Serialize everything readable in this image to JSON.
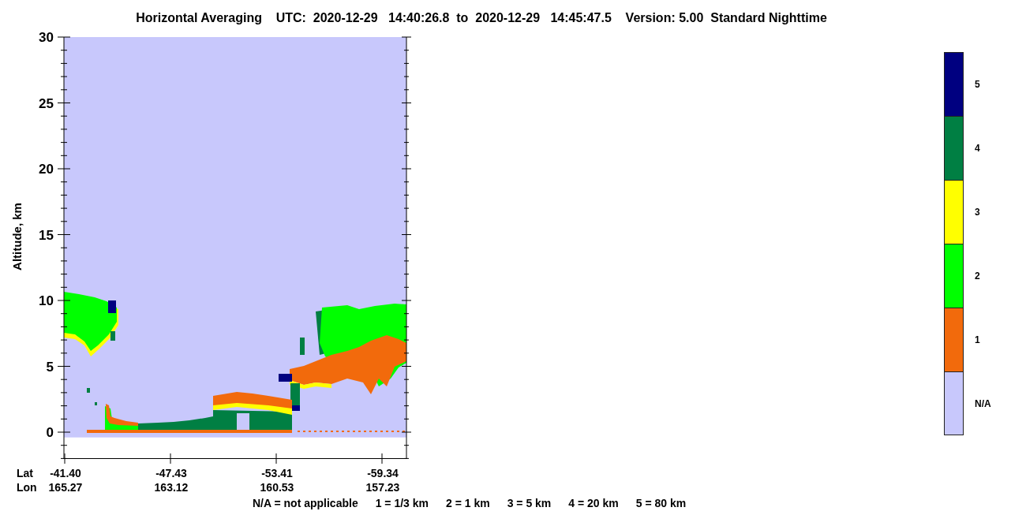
{
  "title": "Horizontal Averaging    UTC:  2020-12-29   14:40:26.8  to  2020-12-29   14:45:47.5    Version: 5.00  Standard Nighttime",
  "plot": {
    "y_axis_label": "Altitude, km",
    "y_ticks": [
      "30",
      "25",
      "20",
      "15",
      "10",
      "5",
      "0"
    ],
    "lat_label": "Lat",
    "lon_label": "Lon",
    "x_ticks": [
      {
        "lat": "-41.40",
        "lon": "165.27"
      },
      {
        "lat": "-47.43",
        "lon": "163.12"
      },
      {
        "lat": "-53.41",
        "lon": "160.53"
      },
      {
        "lat": "-59.34",
        "lon": "157.23"
      }
    ]
  },
  "colorbar": [
    {
      "label": "5",
      "color": "#000080"
    },
    {
      "label": "4",
      "color": "#007f43"
    },
    {
      "label": "3",
      "color": "#ffff00"
    },
    {
      "label": "2",
      "color": "#00ff00"
    },
    {
      "label": "1",
      "color": "#f26a0c"
    },
    {
      "label": "N/A",
      "color": "#c8c8fc"
    }
  ],
  "footer": [
    "N/A = not applicable",
    "1 = 1/3 km",
    "2 = 1 km",
    "3 = 5 km",
    "4 = 20 km",
    "5 = 80 km"
  ]
}
